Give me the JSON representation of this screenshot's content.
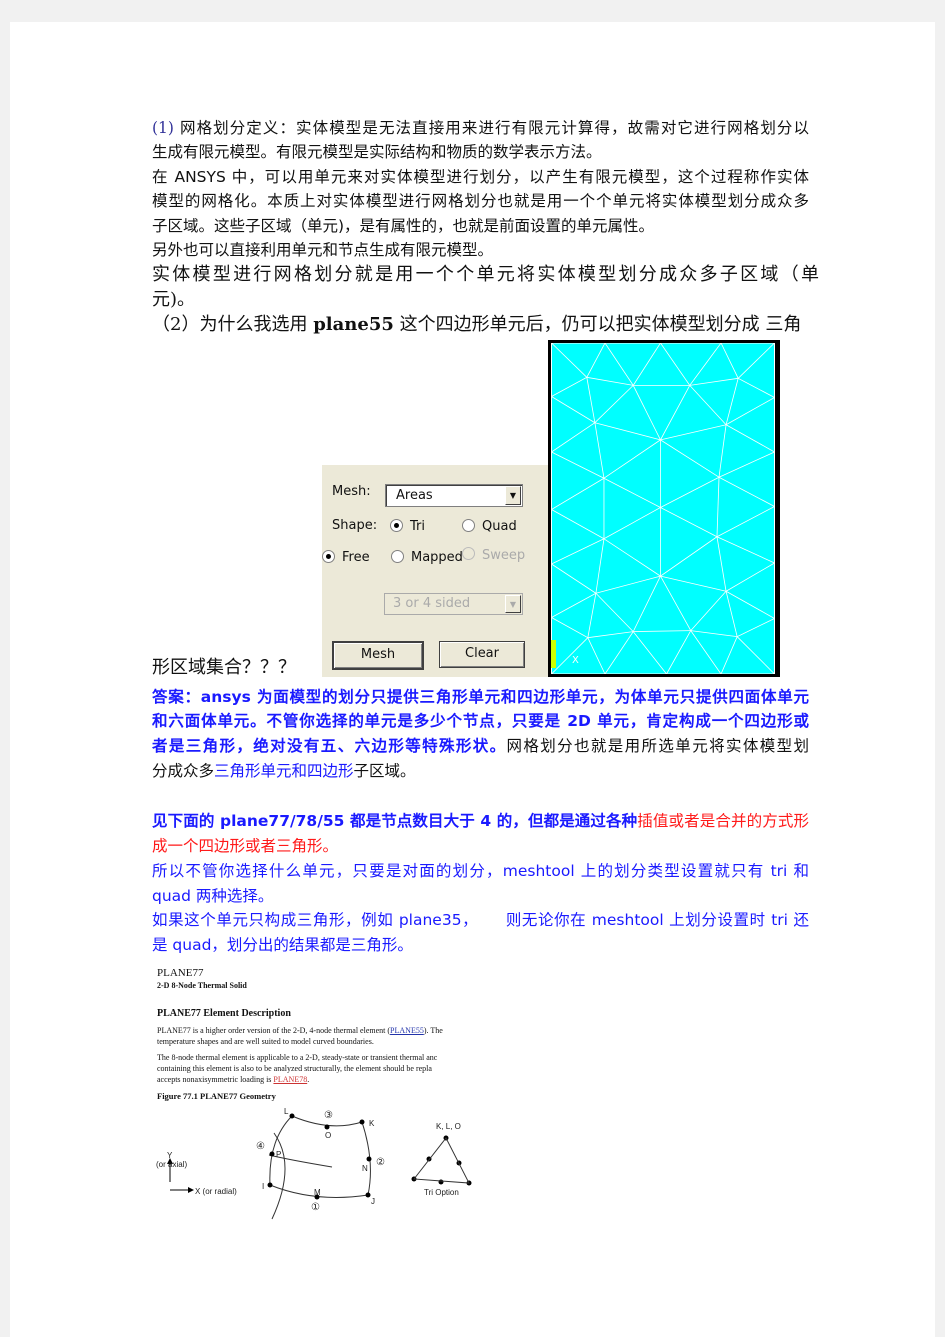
{
  "section1": {
    "marker": "(1)",
    "l1": "网格划分定义：实体模型是无法直接用来进行有限元计算得，故需对它进行网格划分以",
    "l2": "生成有限元模型。有限元模型是实际结构和物质的数学表示方法。",
    "l3": "在 ANSYS 中，可以用单元来对实体模型进行划分，以产生有限元模型，这个过程称作实体",
    "l4": "模型的网格化。本质上对实体模型进行网格划分也就是用一个个单元将实体模型划分成众多",
    "l5": "子区域。这些子区域（单元)，是有属性的，也就是前面设置的单元属性。",
    "l6": "另外也可以直接利用单元和节点生成有限元模型。",
    "l7": "实体模型进行网格划分就是用一个个单元将实体模型划分成众多子区域（单",
    "l8": "元)。"
  },
  "section2": {
    "q1a": "（2）为什么我选用 ",
    "q1b": "plane55",
    "q1c": " 这个四边形单元后，仍可以把实体模型划分成 三角",
    "q2": "形区域集合？？？"
  },
  "meshtool": {
    "mesh_label": "Mesh:",
    "mesh_value": "Areas",
    "shape_label": "Shape:",
    "tri": "Tri",
    "quad": "Quad",
    "free": "Free",
    "mapped": "Mapped",
    "sweep": "Sweep",
    "shape_selected": "Tri",
    "method_selected": "Free",
    "sided_value": "3 or 4 sided",
    "mesh_button": "Mesh",
    "clear_button": "Clear",
    "axis_x": "X"
  },
  "answer": {
    "a1": "答案：ansys 为面模型的划分只提供三角形单元和四边形单元，为体单元只提供四面体单元",
    "a2": "和六面体单元。不管你选择的单元是多少个节点，只要是 2D 单元，肯定构成一个四边形或",
    "a3a": "者是三角形，绝对没有五、六边形等特殊形状。",
    "a3b": "网格划分也就是用所选单元将实体模型划",
    "a4a": "分成众多",
    "a4b": "三角形单元和四边形",
    "a4c": "子区域。",
    "b1a": "见下面的 plane77/78/55 都是节点数目大于 4 的，但都是通过各种",
    "b1b": "插值或者是合并的方式形",
    "b2": "成一个四边形或者三角形。",
    "c1": "所以不管你选择什么单元，只要是对面的划分，meshtool 上的划分类型设置就只有 tri 和",
    "c2": "quad 两种选择。",
    "d1": "如果这个单元只构成三角形，例如 plane35，     则无论你在 meshtool 上划分设置时 tri 还",
    "d2": "是 quad，划分出的结果都是三角形。"
  },
  "plane77": {
    "title": "PLANE77",
    "subtitle": "2-D 8-Node Thermal Solid",
    "heading": "PLANE77 Element Description",
    "p1a": "PLANE77 is a higher order version of the 2-D, 4-node thermal element (",
    "p1link": "PLANE55",
    "p1b": "). The",
    "p1c": "temperature shapes and are well suited to model curved boundaries.",
    "p2a": "The 8-node thermal element is applicable to a 2-D, steady-state or transient thermal anc",
    "p2b": "containing this element is also to be analyzed structurally, the element should be repla",
    "p2c": "accepts nonaxisymmetric loading is ",
    "p2link": "PLANE78",
    "p2d": ".",
    "figure": "Figure 77.1  PLANE77 Geometry",
    "axis_y": "Y",
    "axis_y2": "(or axial)",
    "axis_x": "X (or radial)",
    "nodes": [
      "I",
      "J",
      "K",
      "L",
      "M",
      "N",
      "O",
      "P"
    ],
    "faces": [
      "①",
      "②",
      "③",
      "④"
    ],
    "tri_label": "K, L, O",
    "tri_option": "Tri Option"
  },
  "colors": {
    "blue": "#1a1aff",
    "red": "#ff1a1a",
    "mesh_bg": "#00ffff",
    "dialog_bg": "#ece9d8"
  }
}
